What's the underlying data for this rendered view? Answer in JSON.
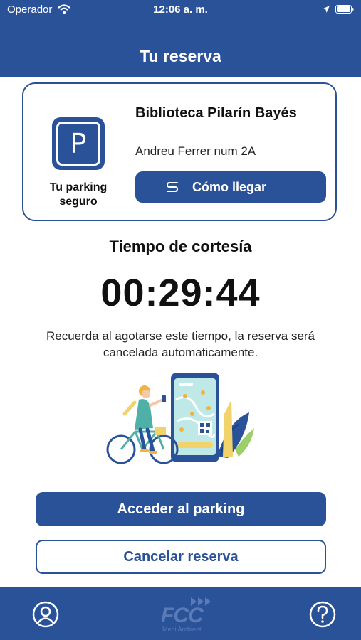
{
  "status_bar": {
    "carrier": "Operador",
    "time": "12:06 a. m."
  },
  "header": {
    "title": "Tu reserva"
  },
  "parking_card": {
    "icon": "parking-icon",
    "icon_letter": "P",
    "caption": "Tu parking seguro",
    "name": "Biblioteca Pilarín Bayés",
    "address": "Andreu Ferrer num 2A",
    "directions_label": "Cómo llegar",
    "directions_icon": "route-icon"
  },
  "courtesy": {
    "title": "Tiempo de cortesía",
    "countdown": "00:29:44",
    "notice": "Recuerda al agotarse este tiempo, la reserva será cancelada automaticamente."
  },
  "actions": {
    "access_label": "Acceder al parking",
    "cancel_label": "Cancelar reserva"
  },
  "tabbar": {
    "logo_text": "FCC",
    "logo_subtext": "Medi Ambient",
    "left_icon": "profile-icon",
    "right_icon": "help-icon"
  },
  "colors": {
    "brand": "#2a5298",
    "background": "#ffffff"
  }
}
